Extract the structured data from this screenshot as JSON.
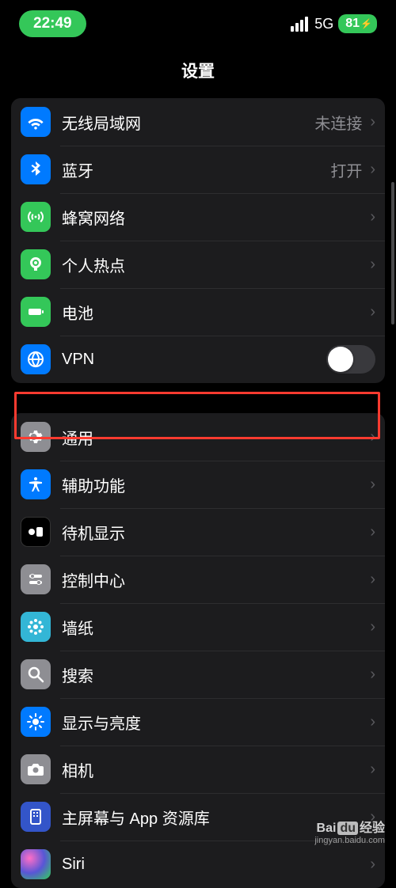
{
  "statusBar": {
    "time": "22:49",
    "network": "5G",
    "battery": "81"
  },
  "header": {
    "title": "设置"
  },
  "group1": {
    "wifi": {
      "label": "无线局域网",
      "value": "未连接"
    },
    "bluetooth": {
      "label": "蓝牙",
      "value": "打开"
    },
    "cellular": {
      "label": "蜂窝网络"
    },
    "hotspot": {
      "label": "个人热点"
    },
    "battery": {
      "label": "电池"
    },
    "vpn": {
      "label": "VPN"
    }
  },
  "group2": {
    "general": {
      "label": "通用"
    },
    "accessibility": {
      "label": "辅助功能"
    },
    "standby": {
      "label": "待机显示"
    },
    "controlCenter": {
      "label": "控制中心"
    },
    "wallpaper": {
      "label": "墙纸"
    },
    "search": {
      "label": "搜索"
    },
    "display": {
      "label": "显示与亮度"
    },
    "camera": {
      "label": "相机"
    },
    "homeScreen": {
      "label": "主屏幕与 App 资源库"
    },
    "siri": {
      "label": "Siri"
    }
  },
  "watermark": {
    "brand": "Baidu 经验",
    "url": "jingyan.baidu.com"
  }
}
